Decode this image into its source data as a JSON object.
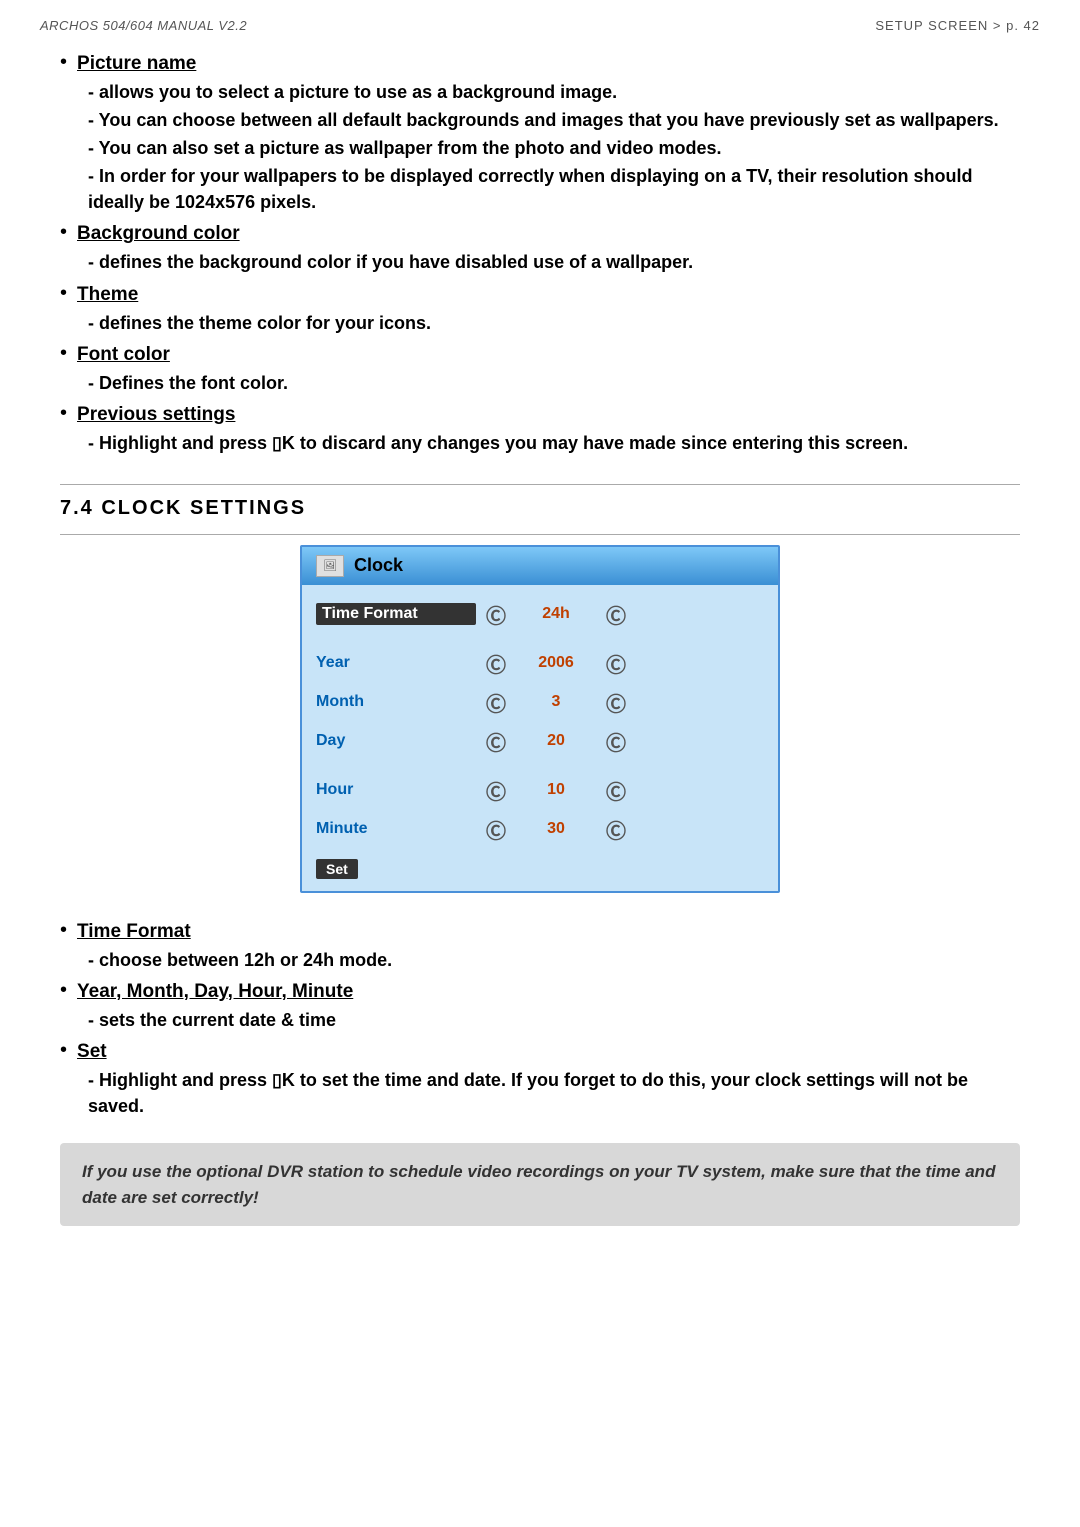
{
  "header": {
    "left": "ARCHOS 504/604  MANUAL V2.2",
    "right": "SETUP SCREEN  >  p. 42"
  },
  "bullet_sections": [
    {
      "id": "picture-name",
      "title": "Picture name",
      "subs": [
        "- allows you to select a picture to use as a background image.",
        "- You can choose between all default backgrounds and images that you have previously set as wallpapers.",
        "- You can also set a picture as wallpaper from the photo and video modes.",
        "- In order for your wallpapers to be displayed correctly when displaying on a TV, their resolution should ideally be 1024x576 pixels."
      ]
    },
    {
      "id": "background-color",
      "title": "Background color",
      "subs": [
        "- defines the background color if you have disabled use of a wallpaper."
      ]
    },
    {
      "id": "theme",
      "title": "Theme",
      "subs": [
        "- defines the theme color for your icons."
      ]
    },
    {
      "id": "font-color",
      "title": "Font color",
      "subs": [
        "- Defines the font color."
      ]
    },
    {
      "id": "previous-settings",
      "title": "Previous settings",
      "subs": [
        "- Highlight and press ▯K to discard any changes you may have made since entering this screen."
      ]
    }
  ],
  "section_74": {
    "title": "7.4  CLOCK SETTINGS"
  },
  "clock_widget": {
    "header_title": "Clock",
    "rows": [
      {
        "label": "Time Format",
        "value": "24h",
        "highlighted": true
      },
      {
        "label": "Year",
        "value": "2006",
        "highlighted": false,
        "colored": true
      },
      {
        "label": "Month",
        "value": "3",
        "highlighted": false,
        "colored": true
      },
      {
        "label": "Day",
        "value": "20",
        "highlighted": false,
        "colored": true
      },
      {
        "label": "Hour",
        "value": "10",
        "highlighted": false,
        "colored": true
      },
      {
        "label": "Minute",
        "value": "30",
        "highlighted": false,
        "colored": true
      }
    ],
    "set_label": "Set"
  },
  "bullet_sections_2": [
    {
      "id": "time-format",
      "title": "Time Format",
      "subs": [
        "- choose between 12h or 24h mode."
      ]
    },
    {
      "id": "year-month-day",
      "title": "Year, Month, Day, Hour, Minute",
      "subs": [
        "- sets the current date & time"
      ]
    },
    {
      "id": "set",
      "title": "Set",
      "subs": [
        "- Highlight and press ▯K to set the time and date. If you forget to do this, your clock settings will not be saved."
      ]
    }
  ],
  "note_box": {
    "text": "If you use the optional DVR station to schedule video recordings on your TV system, make sure that the time and date are set correctly!"
  }
}
